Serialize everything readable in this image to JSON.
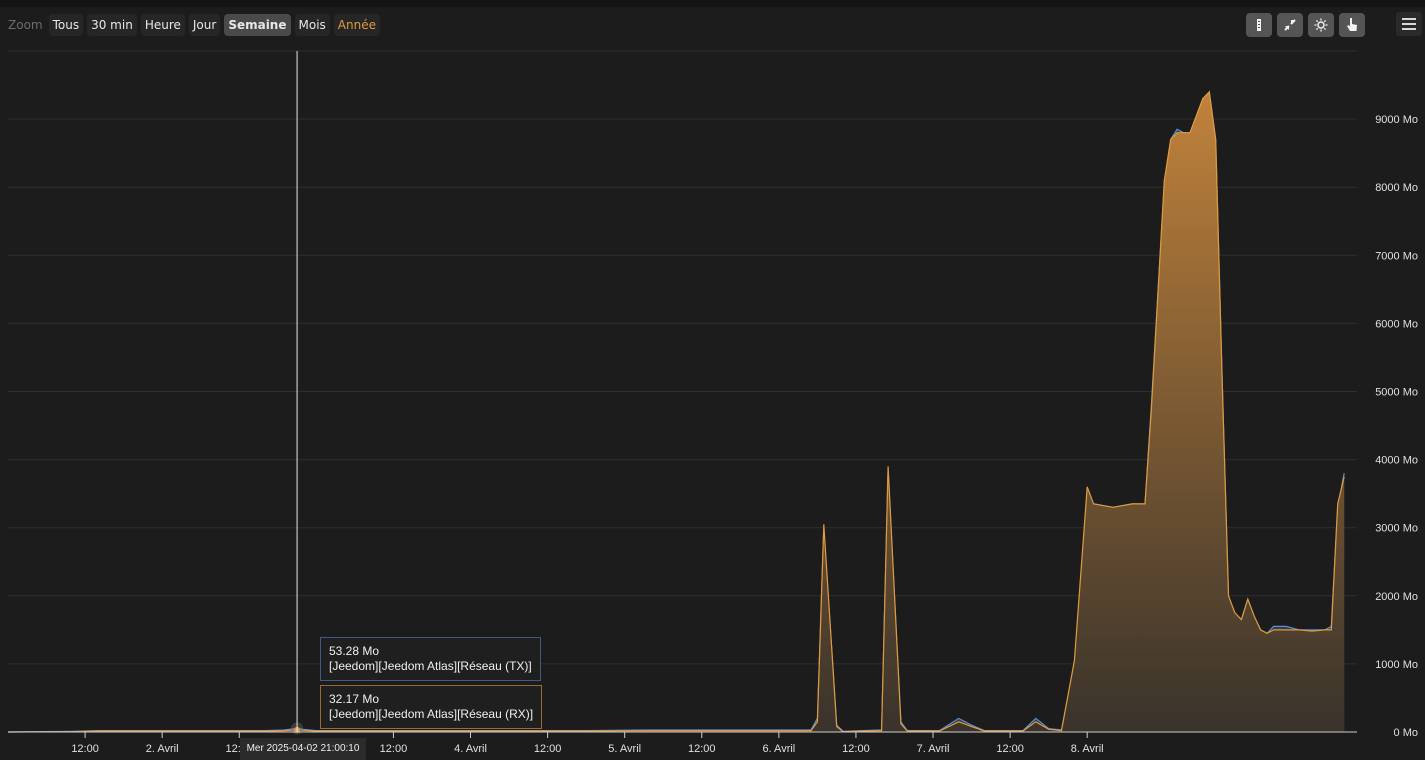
{
  "zoom": {
    "label": "Zoom",
    "buttons": [
      {
        "id": "all",
        "label": "Tous"
      },
      {
        "id": "30min",
        "label": "30 min"
      },
      {
        "id": "hour",
        "label": "Heure"
      },
      {
        "id": "day",
        "label": "Jour"
      },
      {
        "id": "week",
        "label": "Semaine"
      },
      {
        "id": "month",
        "label": "Mois"
      },
      {
        "id": "year",
        "label": "Année"
      }
    ],
    "active": "Semaine"
  },
  "toolbar": {
    "icons": [
      "navigator-icon",
      "compare-icon",
      "theme-icon",
      "pointer-icon",
      "hamburger-menu-icon"
    ]
  },
  "tooltip": {
    "tx": {
      "value": "53.28 Mo",
      "series": "[Jeedom][Jeedom Atlas][Réseau (TX)]"
    },
    "rx": {
      "value": "32.17 Mo",
      "series": "[Jeedom][Jeedom Atlas][Réseau (RX)]"
    }
  },
  "crosshair_label": "Mer 2025-04-02 21:00:10",
  "chart_data": {
    "type": "area",
    "x_axis": {
      "unit": "hours since 2025-04-01 00:00",
      "range": [
        0,
        210
      ],
      "ticks": [
        {
          "x": 12,
          "label": "12:00"
        },
        {
          "x": 24,
          "label": "2. Avril"
        },
        {
          "x": 36,
          "label": "12:00"
        },
        {
          "x": 60,
          "label": "12:00"
        },
        {
          "x": 72,
          "label": "4. Avril"
        },
        {
          "x": 84,
          "label": "12:00"
        },
        {
          "x": 96,
          "label": "5. Avril"
        },
        {
          "x": 108,
          "label": "12:00"
        },
        {
          "x": 120,
          "label": "6. Avril"
        },
        {
          "x": 132,
          "label": "12:00"
        },
        {
          "x": 144,
          "label": "7. Avril"
        },
        {
          "x": 156,
          "label": "12:00"
        },
        {
          "x": 168,
          "label": "8. Avril"
        }
      ]
    },
    "y_axis": {
      "range": [
        0,
        10000
      ],
      "ticks": [
        {
          "v": 0,
          "label": "0 Mo"
        },
        {
          "v": 1000,
          "label": "1000 Mo"
        },
        {
          "v": 2000,
          "label": "2000 Mo"
        },
        {
          "v": 3000,
          "label": "3000 Mo"
        },
        {
          "v": 4000,
          "label": "4000 Mo"
        },
        {
          "v": 5000,
          "label": "5000 Mo"
        },
        {
          "v": 6000,
          "label": "6000 Mo"
        },
        {
          "v": 7000,
          "label": "7000 Mo"
        },
        {
          "v": 8000,
          "label": "8000 Mo"
        },
        {
          "v": 9000,
          "label": "9000 Mo"
        }
      ]
    },
    "grid": true,
    "crosshair_x": 45,
    "series": [
      {
        "name": "[Jeedom][Jeedom Atlas][Réseau (TX)]",
        "color": "#5b8fd6",
        "points": [
          [
            0,
            0
          ],
          [
            10,
            10
          ],
          [
            14,
            20
          ],
          [
            20,
            20
          ],
          [
            40,
            20
          ],
          [
            43,
            30
          ],
          [
            45,
            53
          ],
          [
            46,
            40
          ],
          [
            48,
            20
          ],
          [
            60,
            20
          ],
          [
            90,
            20
          ],
          [
            100,
            30
          ],
          [
            125,
            30
          ],
          [
            126,
            200
          ],
          [
            127,
            3000
          ],
          [
            129,
            100
          ],
          [
            130,
            10
          ],
          [
            133,
            20
          ],
          [
            136,
            30
          ],
          [
            137,
            3850
          ],
          [
            139,
            150
          ],
          [
            140,
            20
          ],
          [
            145,
            20
          ],
          [
            148,
            200
          ],
          [
            150,
            100
          ],
          [
            152,
            20
          ],
          [
            158,
            20
          ],
          [
            160,
            200
          ],
          [
            162,
            50
          ],
          [
            164,
            30
          ],
          [
            166,
            1000
          ],
          [
            168,
            3550
          ],
          [
            169,
            3350
          ],
          [
            172,
            3300
          ],
          [
            175,
            3350
          ],
          [
            177,
            3350
          ],
          [
            178,
            4800
          ],
          [
            180,
            8050
          ],
          [
            181,
            8700
          ],
          [
            182,
            8850
          ],
          [
            183,
            8800
          ],
          [
            184,
            8800
          ],
          [
            186,
            9300
          ],
          [
            187,
            9400
          ],
          [
            188,
            8700
          ],
          [
            189,
            5200
          ],
          [
            190,
            2000
          ],
          [
            191,
            1700
          ],
          [
            192,
            1650
          ],
          [
            193,
            1950
          ],
          [
            194,
            1700
          ],
          [
            195,
            1500
          ],
          [
            196,
            1450
          ],
          [
            197,
            1550
          ],
          [
            199,
            1550
          ],
          [
            201,
            1500
          ],
          [
            203,
            1500
          ],
          [
            205,
            1500
          ],
          [
            206,
            1550
          ],
          [
            207,
            3300
          ],
          [
            208,
            3800
          ]
        ]
      },
      {
        "name": "[Jeedom][Jeedom Atlas][Réseau (RX)]",
        "color": "#e09a3c",
        "points": [
          [
            0,
            0
          ],
          [
            10,
            5
          ],
          [
            14,
            15
          ],
          [
            20,
            15
          ],
          [
            40,
            15
          ],
          [
            43,
            20
          ],
          [
            45,
            32
          ],
          [
            46,
            25
          ],
          [
            48,
            15
          ],
          [
            60,
            15
          ],
          [
            90,
            15
          ],
          [
            100,
            20
          ],
          [
            125,
            20
          ],
          [
            126,
            150
          ],
          [
            127,
            3050
          ],
          [
            129,
            80
          ],
          [
            130,
            5
          ],
          [
            133,
            15
          ],
          [
            136,
            20
          ],
          [
            137,
            3900
          ],
          [
            139,
            120
          ],
          [
            140,
            15
          ],
          [
            145,
            15
          ],
          [
            148,
            150
          ],
          [
            150,
            80
          ],
          [
            152,
            15
          ],
          [
            158,
            15
          ],
          [
            160,
            150
          ],
          [
            162,
            40
          ],
          [
            164,
            20
          ],
          [
            166,
            1050
          ],
          [
            168,
            3600
          ],
          [
            169,
            3350
          ],
          [
            172,
            3300
          ],
          [
            175,
            3350
          ],
          [
            177,
            3350
          ],
          [
            178,
            4750
          ],
          [
            180,
            8100
          ],
          [
            181,
            8700
          ],
          [
            182,
            8800
          ],
          [
            183,
            8800
          ],
          [
            184,
            8800
          ],
          [
            186,
            9300
          ],
          [
            187,
            9400
          ],
          [
            188,
            8700
          ],
          [
            189,
            5200
          ],
          [
            190,
            2000
          ],
          [
            191,
            1750
          ],
          [
            192,
            1650
          ],
          [
            193,
            1950
          ],
          [
            194,
            1700
          ],
          [
            195,
            1500
          ],
          [
            196,
            1450
          ],
          [
            197,
            1500
          ],
          [
            199,
            1500
          ],
          [
            201,
            1500
          ],
          [
            203,
            1480
          ],
          [
            205,
            1500
          ],
          [
            206,
            1500
          ],
          [
            207,
            3350
          ],
          [
            208,
            3750
          ]
        ]
      }
    ]
  }
}
